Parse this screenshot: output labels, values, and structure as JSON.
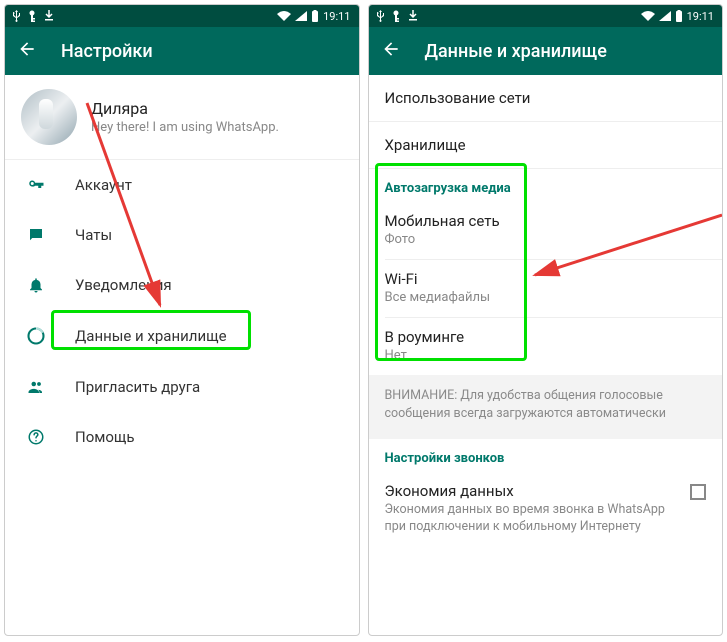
{
  "status": {
    "time": "19:11"
  },
  "left": {
    "title": "Настройки",
    "profile": {
      "name": "Диляра",
      "status": "Hey there! I am using WhatsApp."
    },
    "items": [
      {
        "id": "account",
        "label": "Аккаунт"
      },
      {
        "id": "chats",
        "label": "Чаты"
      },
      {
        "id": "notifications",
        "label": "Уведомления"
      },
      {
        "id": "data",
        "label": "Данные и хранилище"
      },
      {
        "id": "invite",
        "label": "Пригласить друга"
      },
      {
        "id": "help",
        "label": "Помощь"
      }
    ]
  },
  "right": {
    "title": "Данные и хранилище",
    "usage": "Использование сети",
    "storage": "Хранилище",
    "autodownload_header": "Автозагрузка медиа",
    "mobile": {
      "title": "Мобильная сеть",
      "sub": "Фото"
    },
    "wifi": {
      "title": "Wi-Fi",
      "sub": "Все медиафайлы"
    },
    "roaming": {
      "title": "В роуминге",
      "sub": "Нет"
    },
    "note": "ВНИМАНИЕ: Для удобства общения голосовые сообщения всегда загружаются автоматически",
    "calls_header": "Настройки звонков",
    "dataSaver": {
      "title": "Экономия данных",
      "sub": "Экономия данных во время звонка в WhatsApp при подключении к мобильному Интернету"
    }
  }
}
